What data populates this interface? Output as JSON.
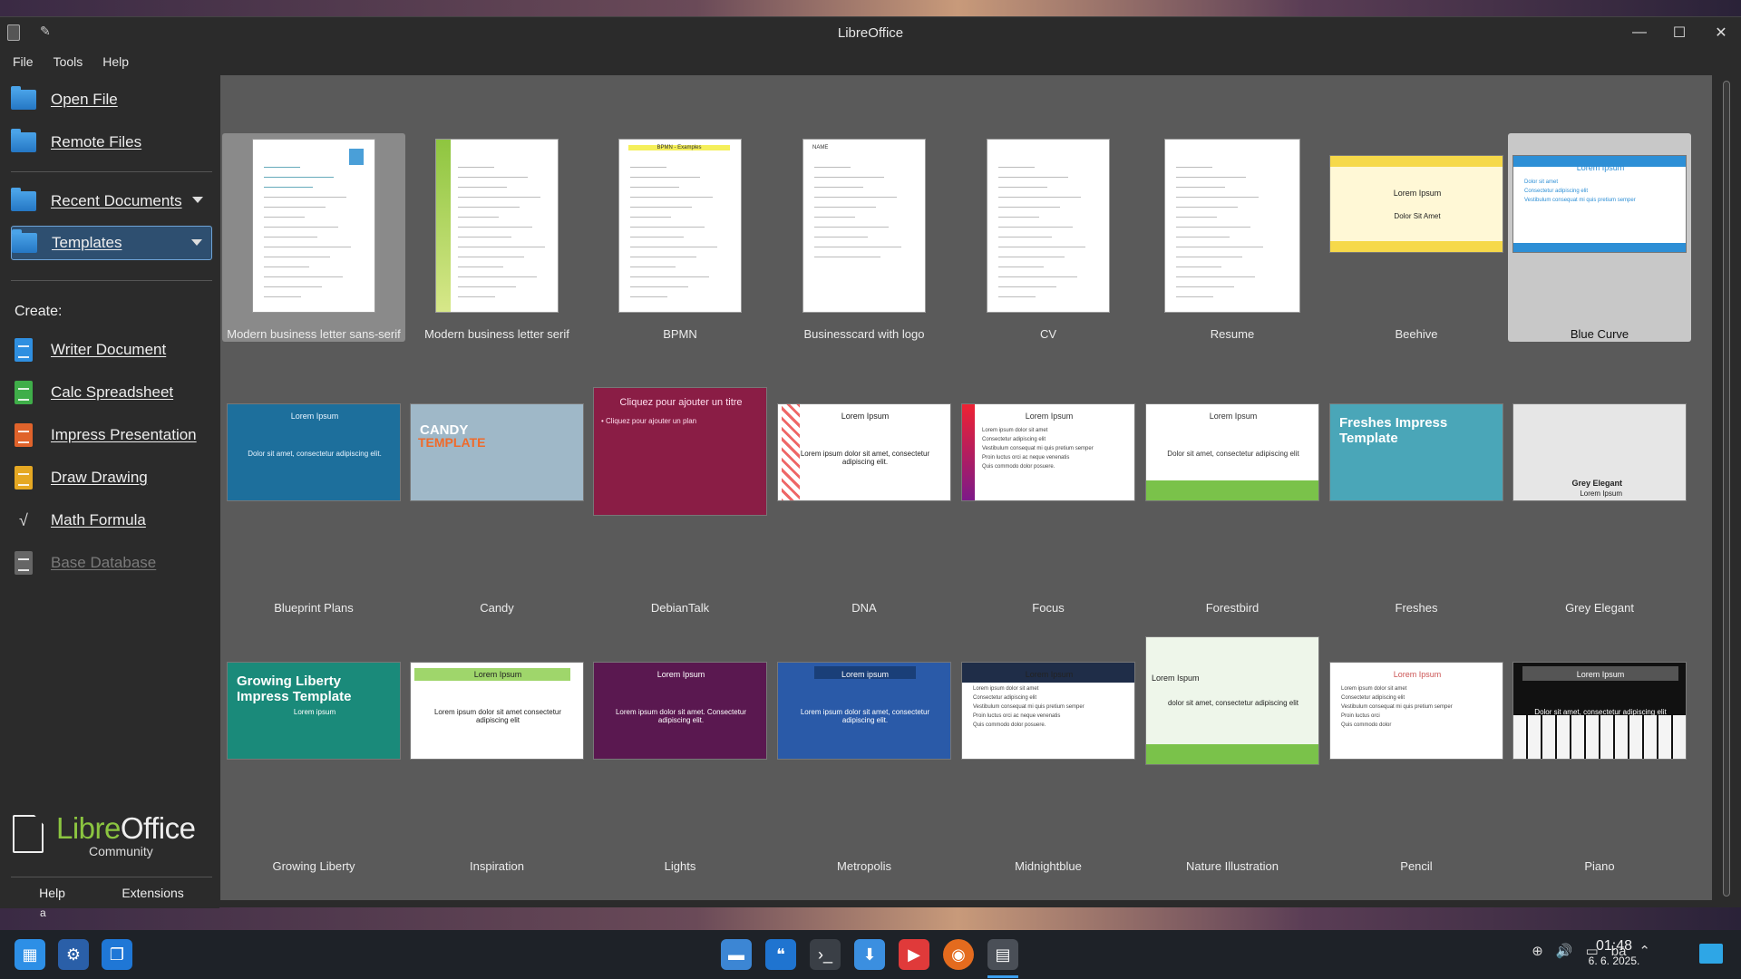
{
  "window": {
    "title": "LibreOffice"
  },
  "menu": [
    "File",
    "Tools",
    "Help"
  ],
  "sidebar": {
    "open_file": "Open File",
    "remote_files": "Remote Files",
    "recent_documents": "Recent Documents",
    "templates": "Templates",
    "create_label": "Create:",
    "create": [
      "Writer Document",
      "Calc Spreadsheet",
      "Impress Presentation",
      "Draw Drawing",
      "Math Formula",
      "Base Database"
    ],
    "logo_libre": "Libre",
    "logo_office": "Office",
    "logo_community": "Community",
    "help": "Help",
    "extensions": "Extensions"
  },
  "templates": [
    {
      "name": "Modern business letter sans-serif",
      "kind": "letter"
    },
    {
      "name": "Modern business letter serif",
      "kind": "letter2"
    },
    {
      "name": "BPMN",
      "kind": "bpmn",
      "text": "BPMN - Examples"
    },
    {
      "name": "Businesscard with logo",
      "kind": "cards",
      "text": "NAME"
    },
    {
      "name": "CV",
      "kind": "cv"
    },
    {
      "name": "Resume",
      "kind": "resume"
    },
    {
      "name": "Beehive",
      "kind": "slide",
      "t1": "Lorem Ipsum",
      "t2": "Dolor Sit Amet"
    },
    {
      "name": "Blue Curve",
      "kind": "slide",
      "t1": "Lorem Ipsum",
      "items": [
        "Dolor sit amet",
        "Consectetur adipiscing elit",
        "Vestibulum consequat mi quis pretium semper"
      ]
    },
    {
      "name": "Blueprint Plans",
      "kind": "slide",
      "t1": "Lorem Ipsum",
      "t2": "Dolor sit amet, consectetur adipiscing elit."
    },
    {
      "name": "Candy",
      "kind": "slide",
      "t1": "CANDY",
      "t2": "TEMPLATE"
    },
    {
      "name": "DebianTalk",
      "kind": "slide",
      "t1": "Cliquez pour ajouter un titre",
      "t2": "• Cliquez pour ajouter un plan"
    },
    {
      "name": "DNA",
      "kind": "slide",
      "t1": "Lorem Ipsum",
      "t2": "Lorem ipsum dolor sit amet, consectetur adipiscing elit."
    },
    {
      "name": "Focus",
      "kind": "slide",
      "t1": "Lorem Ipsum",
      "items": [
        "Lorem ipsum dolor sit amet",
        "Consectetur adipiscing elit",
        "Vestibulum consequat mi quis pretium semper",
        "Proin luctus orci ac neque venenatis",
        "Quis commodo dolor posuere."
      ]
    },
    {
      "name": "Forestbird",
      "kind": "slide",
      "t1": "Lorem Ipsum",
      "t2": "Dolor sit amet, consectetur adipiscing elit"
    },
    {
      "name": "Freshes",
      "kind": "slide",
      "t1": "Freshes Impress Template"
    },
    {
      "name": "Grey Elegant",
      "kind": "slide",
      "t1": "Grey Elegant",
      "t2": "Lorem Ipsum"
    },
    {
      "name": "Growing Liberty",
      "kind": "slide",
      "t1": "Growing Liberty Impress Template",
      "t2": "Lorem ipsum"
    },
    {
      "name": "Inspiration",
      "kind": "slide",
      "t1": "Lorem Ipsum",
      "t2": "Lorem ipsum dolor sit amet consectetur adipiscing elit"
    },
    {
      "name": "Lights",
      "kind": "slide",
      "t1": "Lorem Ipsum",
      "t2": "Lorem ipsum dolor sit amet. Consectetur adipiscing elit."
    },
    {
      "name": "Metropolis",
      "kind": "slide",
      "t1": "Lorem ipsum",
      "t2": "Lorem ipsum dolor sit amet, consectetur adipiscing elit."
    },
    {
      "name": "Midnightblue",
      "kind": "slide",
      "t1": "Lorem Ipsum",
      "items": [
        "Lorem ipsum dolor sit amet",
        "Consectetur adipiscing elit",
        "Vestibulum consequat mi quis pretium semper",
        "Proin luctus orci ac neque venenatis",
        "Quis commodo dolor posuere."
      ]
    },
    {
      "name": "Nature Illustration",
      "kind": "slide",
      "t1": "Lorem Ispum",
      "t2": "dolor sit amet, consectetur adipiscing elit"
    },
    {
      "name": "Pencil",
      "kind": "slide",
      "t1": "Lorem Ipsum",
      "items": [
        "Lorem ipsum dolor sit amet",
        "Consectetur adipiscing elit",
        "Vestibulum consequat mi quis pretium semper",
        "Proin luctus orci",
        "Quis commodo dolor"
      ]
    },
    {
      "name": "Piano",
      "kind": "slide",
      "t1": "Lorem Ipsum",
      "t2": "Dolor sit amet, consectetur adipiscing elit"
    }
  ],
  "taskbar": {
    "keyboard": "ba",
    "time": "01:48",
    "date": "6. 6. 2025."
  },
  "stray_text": "a",
  "colors": {
    "selected_border": "#6fa3d6",
    "libre_green": "#8bc540",
    "main_bg": "#5a5a5a",
    "sidebar_bg": "#2b2b2b"
  }
}
